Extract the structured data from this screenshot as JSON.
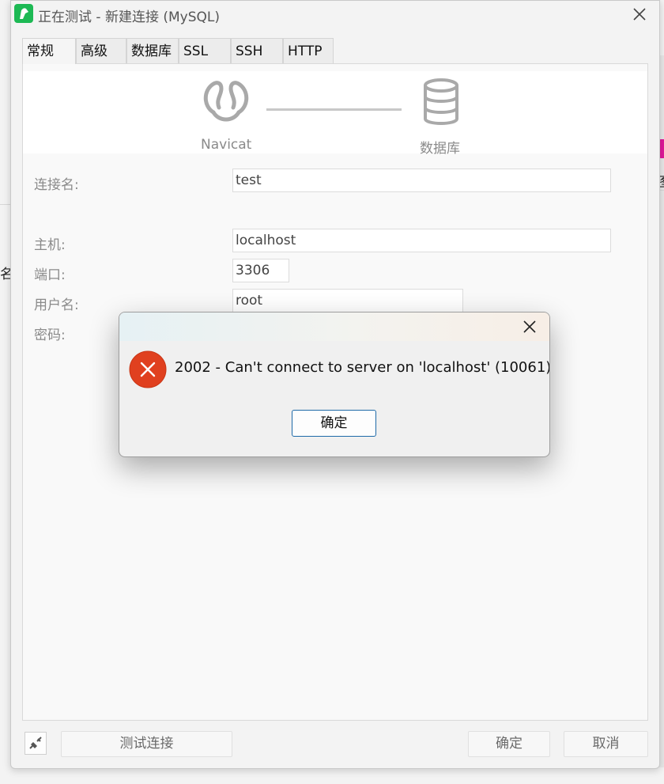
{
  "window": {
    "title": "正在测试 - 新建连接 (MySQL)"
  },
  "tabs": [
    "常规",
    "高级",
    "数据库",
    "SSL",
    "SSH",
    "HTTP"
  ],
  "active_tab": "常规",
  "hero": {
    "left_label": "Navicat",
    "right_label": "数据库"
  },
  "form": {
    "connection_name": {
      "label": "连接名:",
      "value": "test"
    },
    "host": {
      "label": "主机:",
      "value": "localhost"
    },
    "port": {
      "label": "端口:",
      "value": "3306"
    },
    "username": {
      "label": "用户名:",
      "value": "root"
    },
    "password": {
      "label": "密码:"
    }
  },
  "bottom": {
    "test_button": "测试连接",
    "ok_button": "确定",
    "cancel_button": "取消"
  },
  "dialog": {
    "message": "2002 - Can't connect to server on 'localhost' (10061)",
    "ok_button": "确定"
  },
  "background": {
    "left_glyph": "名",
    "right_glyph": "图"
  },
  "colors": {
    "error": "#e0401f",
    "focus_border": "#1f6aa8",
    "app_icon": "#1db954"
  }
}
